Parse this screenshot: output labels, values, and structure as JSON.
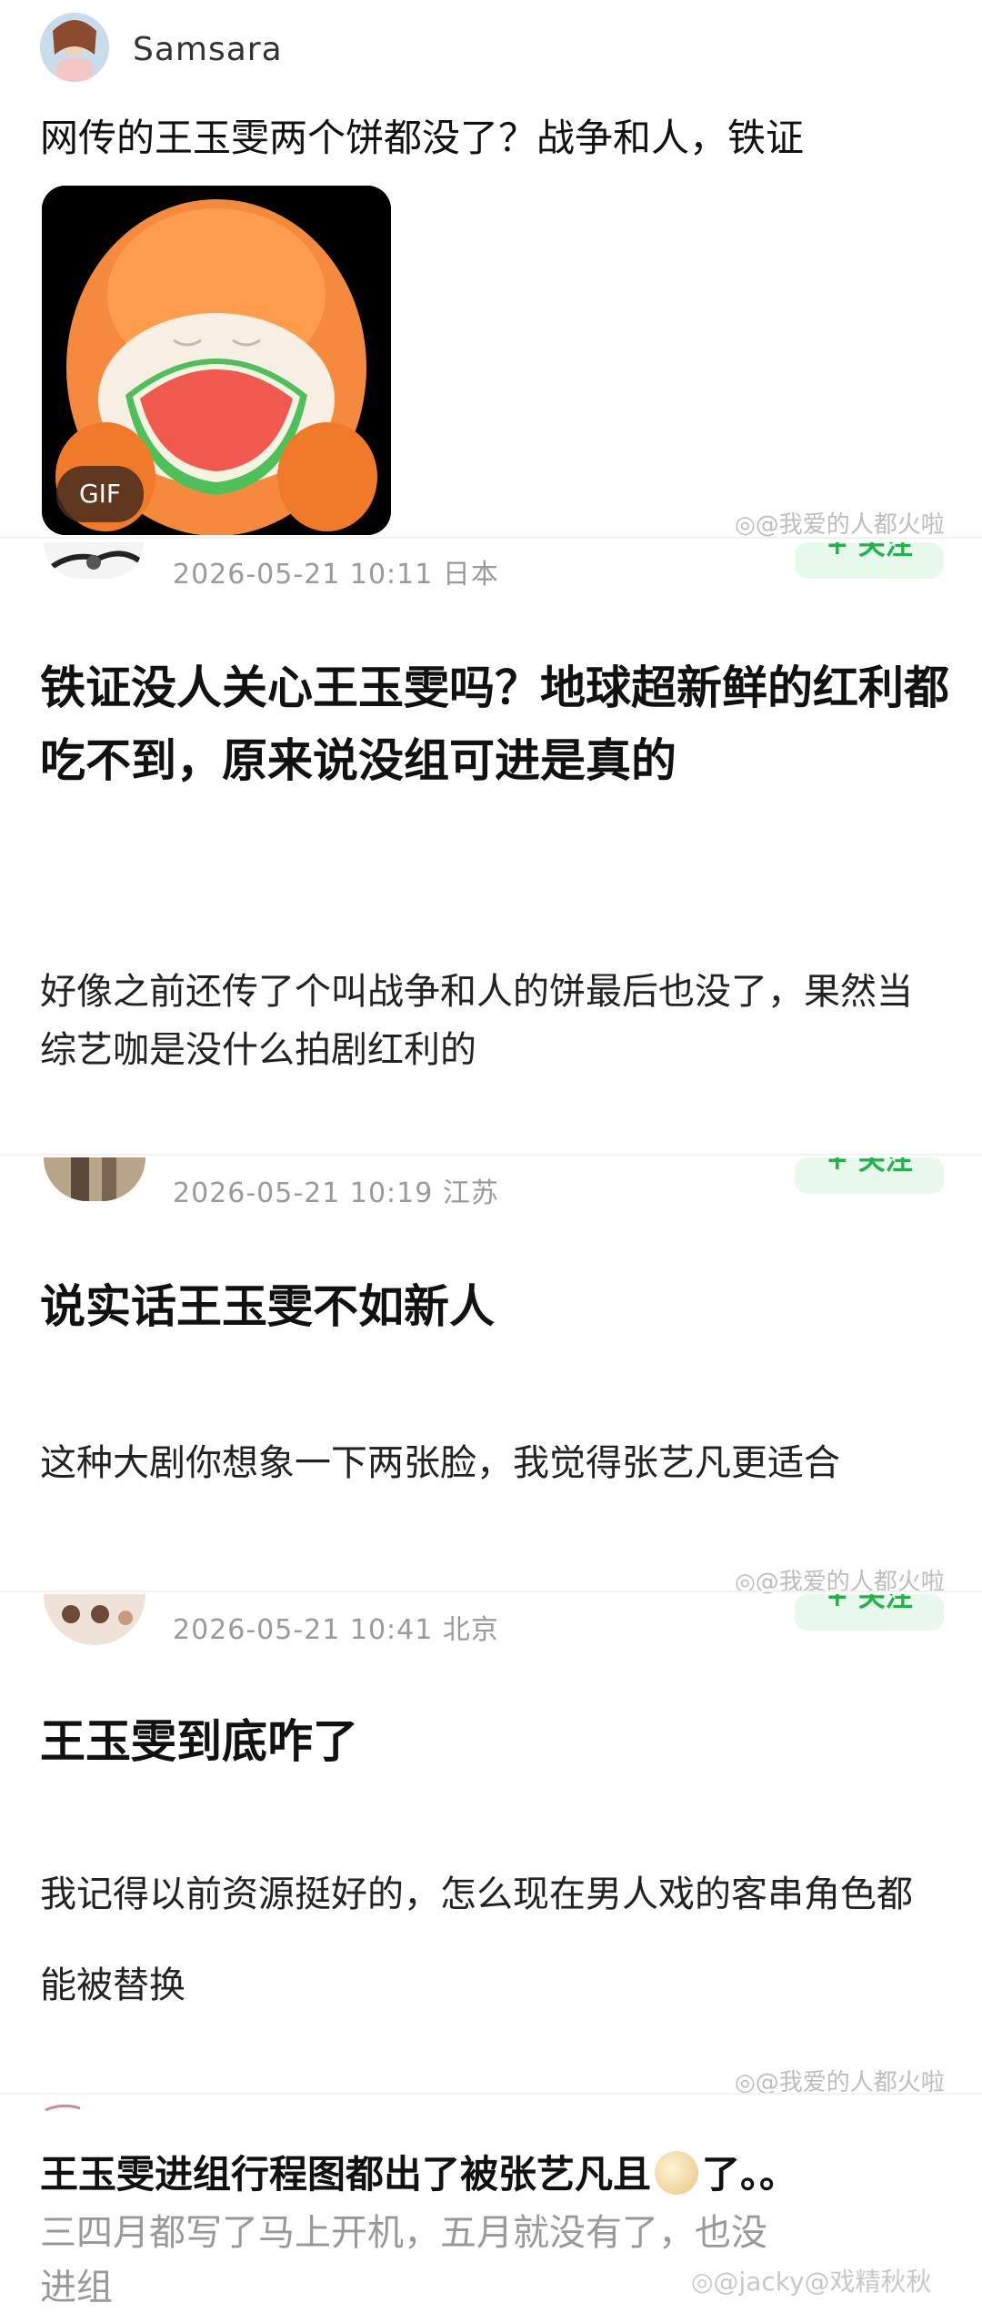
{
  "post": {
    "username": "Samsara",
    "text": "网传的王玉雯两个饼都没了？战争和人，铁证",
    "gif_badge": "GIF",
    "watermark": "@我爱的人都火啦"
  },
  "comments": [
    {
      "timestamp": "2026-05-21 10:11",
      "location": "日本",
      "follow_label": "+ 关注",
      "title": "铁证没人关心王玉雯吗？地球超新鲜的红利都吃不到，原来说没组可进是真的",
      "body": "好像之前还传了个叫战争和人的饼最后也没了，果然当综艺咖是没什么拍剧红利的"
    },
    {
      "timestamp": "2026-05-21 10:19",
      "location": "江苏",
      "follow_label": "+ 关注",
      "title": "说实话王玉雯不如新人",
      "body": "这种大剧你想象一下两张脸，我觉得张艺凡更适合",
      "watermark": "@我爱的人都火啦"
    },
    {
      "timestamp": "2026-05-21 10:41",
      "location": "北京",
      "follow_label": "+ 关注",
      "title": "王玉雯到底咋了",
      "body": "我记得以前资源挺好的，怎么现在男人戏的客串角色都能被替换",
      "watermark": "@我爱的人都火啦"
    }
  ],
  "bottom": {
    "title_before": "王玉雯进组行程图都出了被张艺凡且",
    "title_after": "了。。",
    "emoji_icon": "gold-coin-emoji-icon",
    "faded_line1": "三四月都写了马上开机，五月就没有了，也没",
    "faded_line2": "进组",
    "watermark": "@jacky@戏精秋秋"
  },
  "colors": {
    "follow_green": "#21b24a",
    "follow_bg": "#e8f8ec",
    "meta_gray": "#9a9a9a"
  }
}
